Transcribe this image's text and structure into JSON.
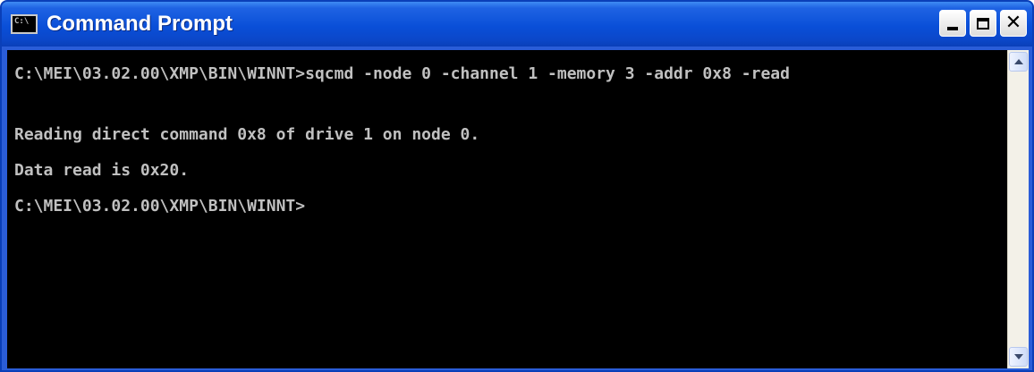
{
  "window": {
    "title": "Command Prompt",
    "icon_label": "C:\\",
    "icon": "console-app-icon"
  },
  "title_buttons": {
    "minimize_icon": "minimize-icon",
    "maximize_icon": "maximize-icon",
    "close_icon": "close-icon",
    "close_glyph": "✕"
  },
  "console": {
    "lines": [
      "C:\\MEI\\03.02.00\\XMP\\BIN\\WINNT>sqcmd -node 0 -channel 1 -memory 3 -addr 0x8 -read",
      "Reading direct command 0x8 of drive 1 on node 0.",
      "Data read is 0x20.",
      "C:\\MEI\\03.02.00\\XMP\\BIN\\WINNT>"
    ]
  },
  "colors": {
    "titlebar": "#0a4fd8",
    "console_bg": "#000000",
    "console_text": "#c0c0c0"
  }
}
